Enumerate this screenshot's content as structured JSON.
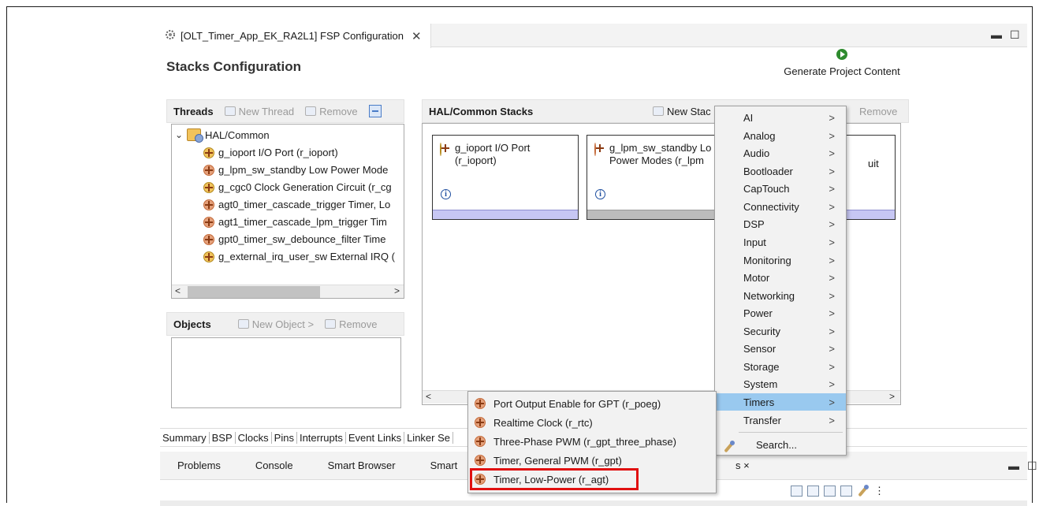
{
  "editor": {
    "tab_title": "[OLT_Timer_App_EK_RA2L1] FSP Configuration",
    "minimize": "▭",
    "maximize": "☐",
    "page_title": "Stacks Configuration",
    "generate_label": "Generate Project Content"
  },
  "threads": {
    "title": "Threads",
    "new_thread": "New Thread",
    "remove": "Remove",
    "root": "HAL/Common",
    "items": [
      "g_ioport I/O Port (r_ioport)",
      "g_lpm_sw_standby Low Power Mode",
      "g_cgc0 Clock Generation Circuit (r_cg",
      "agt0_timer_cascade_trigger Timer, Lo",
      "agt1_timer_cascade_lpm_trigger Tim",
      "gpt0_timer_sw_debounce_filter Time",
      "g_external_irq_user_sw External IRQ ("
    ]
  },
  "objects": {
    "title": "Objects",
    "new_object": "New Object >",
    "remove": "Remove"
  },
  "stacks": {
    "title": "HAL/Common Stacks",
    "new_stack": "New Stac",
    "remove": "Remove",
    "cards": [
      {
        "line1": "g_ioport I/O Port",
        "line2": "(r_ioport)"
      },
      {
        "line1": "g_lpm_sw_standby Lo",
        "line2": "Power Modes (r_lpm"
      },
      {
        "line1": "uit",
        "line2": ""
      }
    ],
    "info_glyph": "i"
  },
  "bottom_tabs": [
    "Summary",
    "BSP",
    "Clocks",
    "Pins",
    "Interrupts",
    "Event Links",
    "Linker Se"
  ],
  "views": [
    "Problems",
    "Console",
    "Smart Browser",
    "Smart"
  ],
  "views_extra": "s ×",
  "menu": {
    "items": [
      "AI",
      "Analog",
      "Audio",
      "Bootloader",
      "CapTouch",
      "Connectivity",
      "DSP",
      "Input",
      "Monitoring",
      "Motor",
      "Networking",
      "Power",
      "Security",
      "Sensor",
      "Storage",
      "System",
      "Timers",
      "Transfer"
    ],
    "selected": "Timers",
    "search": "Search...",
    "arrow": ">"
  },
  "submenu": {
    "items": [
      "Port Output Enable for GPT (r_poeg)",
      "Realtime Clock (r_rtc)",
      "Three-Phase PWM (r_gpt_three_phase)",
      "Timer, General PWM (r_gpt)",
      "Timer, Low-Power (r_agt)"
    ],
    "highlighted": "Timer, Low-Power (r_agt)"
  },
  "colors": {
    "menu_selected": "#99c9ef",
    "highlight_border": "#e01010",
    "card_bar": "#c7c7f3"
  },
  "icons": [
    "gear-icon",
    "close-icon",
    "play-icon",
    "component-icon",
    "folder-icon",
    "info-icon",
    "wrench-icon",
    "chevron-right-icon"
  ]
}
